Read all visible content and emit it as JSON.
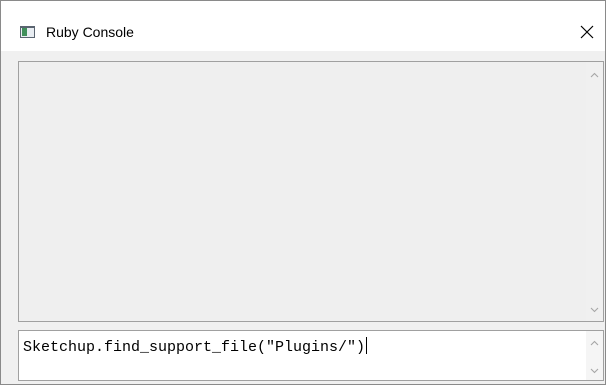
{
  "window": {
    "title": "Ruby Console",
    "app_icon": "ruby-console-window-icon",
    "close_icon": "close-icon"
  },
  "output": {
    "text": "",
    "scroll_up_icon": "chevron-up-icon",
    "scroll_down_icon": "chevron-down-icon"
  },
  "input": {
    "value": "Sketchup.find_support_file(\"Plugins/\")",
    "scroll_up_icon": "chevron-up-icon",
    "scroll_down_icon": "chevron-down-icon"
  },
  "colors": {
    "titlebar": "#ffffff",
    "client_background": "#f0f0f0",
    "output_background": "#efefef",
    "input_background": "#ffffff",
    "border": "#a0a0a0"
  }
}
